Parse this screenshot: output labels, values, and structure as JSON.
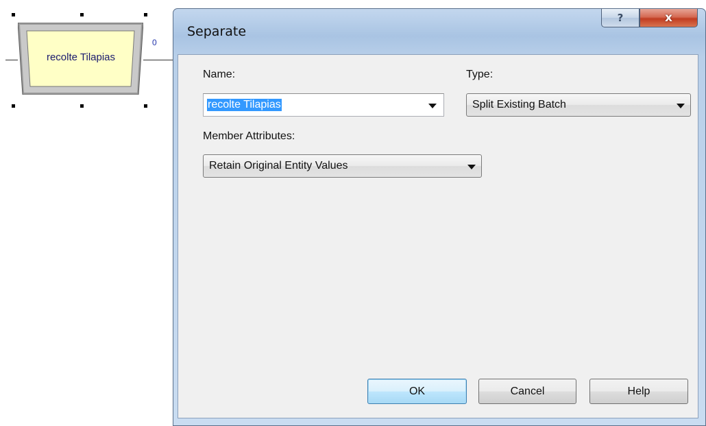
{
  "canvas": {
    "module_label": "recolte Tilapias",
    "port_label": "0"
  },
  "dialog": {
    "title": "Separate",
    "help_glyph": "?",
    "close_glyph": "x",
    "name_label": "Name:",
    "name_value": "recolte Tilapias",
    "type_label": "Type:",
    "type_value": "Split Existing Batch",
    "member_attributes_label": "Member Attributes:",
    "member_attributes_value": "Retain Original Entity Values",
    "buttons": {
      "ok": "OK",
      "cancel": "Cancel",
      "help": "Help"
    }
  },
  "colors": {
    "module_fill": "#ffffc6",
    "selection_highlight": "#3399ff",
    "close_button": "#c13d22"
  },
  "icons": [
    "help-icon",
    "close-icon",
    "dropdown-arrow-icon"
  ]
}
